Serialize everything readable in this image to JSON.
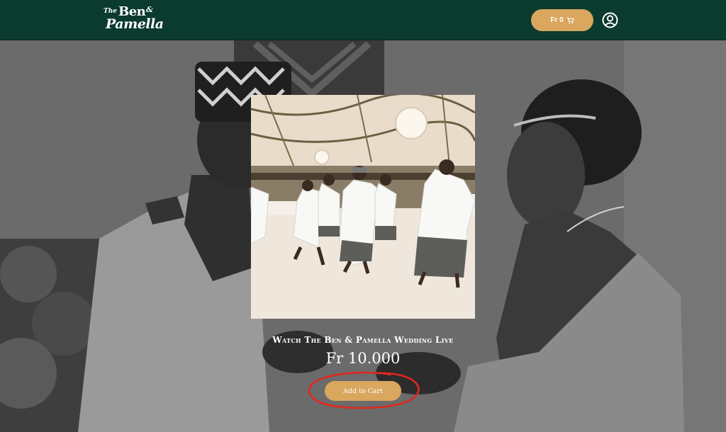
{
  "header": {
    "logo": {
      "the": "The",
      "ben": "Ben",
      "amp": "&",
      "pamella": "Pamella"
    },
    "cart": {
      "label": "Fr 0",
      "icon": "cart-icon"
    },
    "account_icon": "user-circle-icon"
  },
  "product": {
    "title": "Watch The Ben & Pamella Wedding Live",
    "price": "Fr 10.000",
    "add_to_cart_label": "Add to Cart"
  },
  "colors": {
    "header_bg": "#0b3a2e",
    "accent": "#d9a75e",
    "annotation": "#e0281e"
  }
}
